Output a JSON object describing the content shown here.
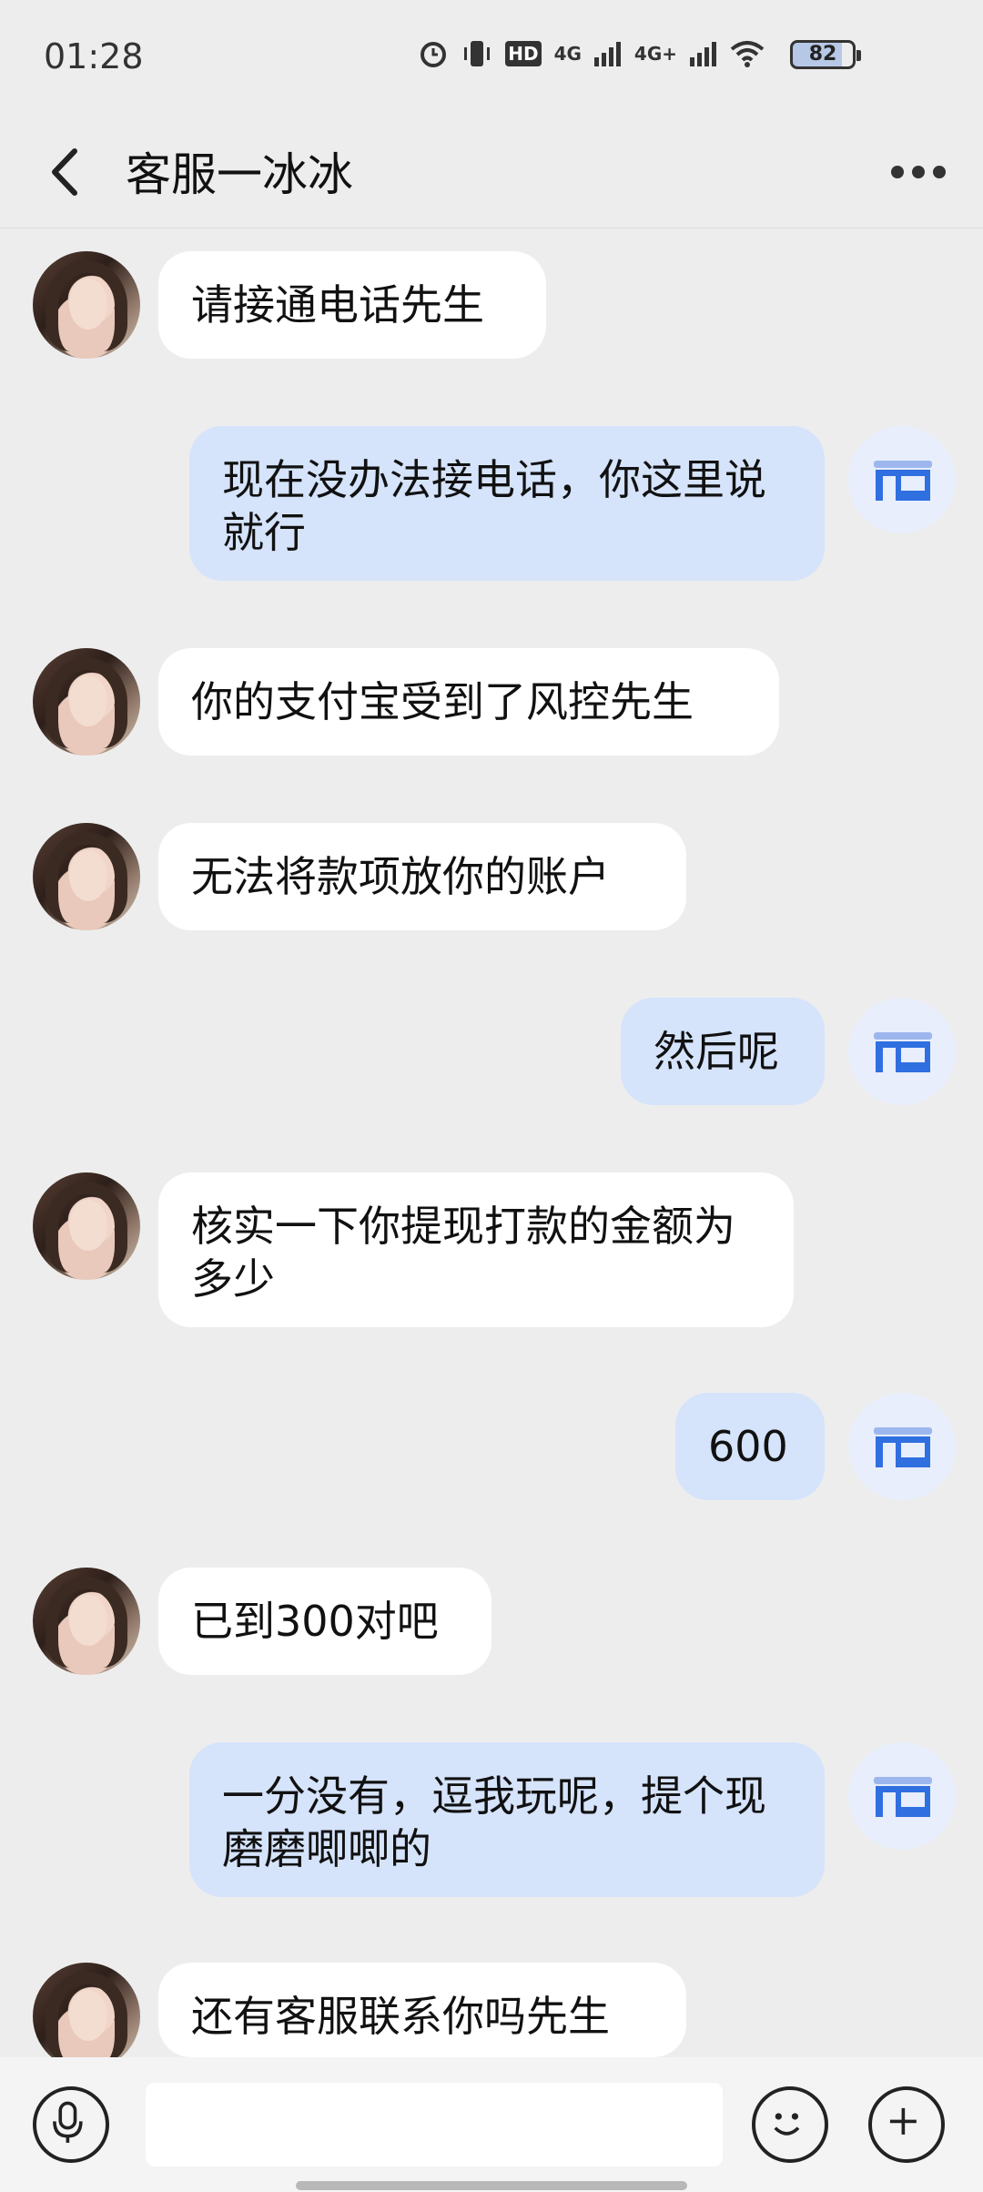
{
  "status_bar": {
    "time": "01:28",
    "battery": "82",
    "network_1": "4G",
    "network_2": "4G+",
    "hd": "HD"
  },
  "header": {
    "title": "客服一冰冰"
  },
  "messages": [
    {
      "side": "in",
      "text": "请接通电话先生"
    },
    {
      "side": "out",
      "text": "现在没办法接电话，你这里说就行"
    },
    {
      "side": "in",
      "text": "你的支付宝受到了风控先生"
    },
    {
      "side": "in",
      "text": "无法将款项放你的账户"
    },
    {
      "side": "out",
      "text": "然后呢"
    },
    {
      "side": "in",
      "text": "核实一下你提现打款的金额为多少"
    },
    {
      "side": "out",
      "text": "600"
    },
    {
      "side": "in",
      "text": "已到300对吧"
    },
    {
      "side": "out",
      "text": "一分没有，逗我玩呢，提个现磨磨唧唧的"
    },
    {
      "side": "in",
      "text": "还有客服联系你吗先生"
    }
  ],
  "input": {
    "value": "",
    "placeholder": ""
  },
  "icons": {
    "back": "chevron-left-icon",
    "more": "more-dots-icon",
    "voice": "microphone-icon",
    "emoji": "smile-icon",
    "add": "plus-icon",
    "shop_avatar": "store-icon"
  },
  "colors": {
    "background": "#ededed",
    "incoming_bubble": "#ffffff",
    "outgoing_bubble": "#d5e3fb",
    "shop_blue": "#2f6fe0"
  }
}
